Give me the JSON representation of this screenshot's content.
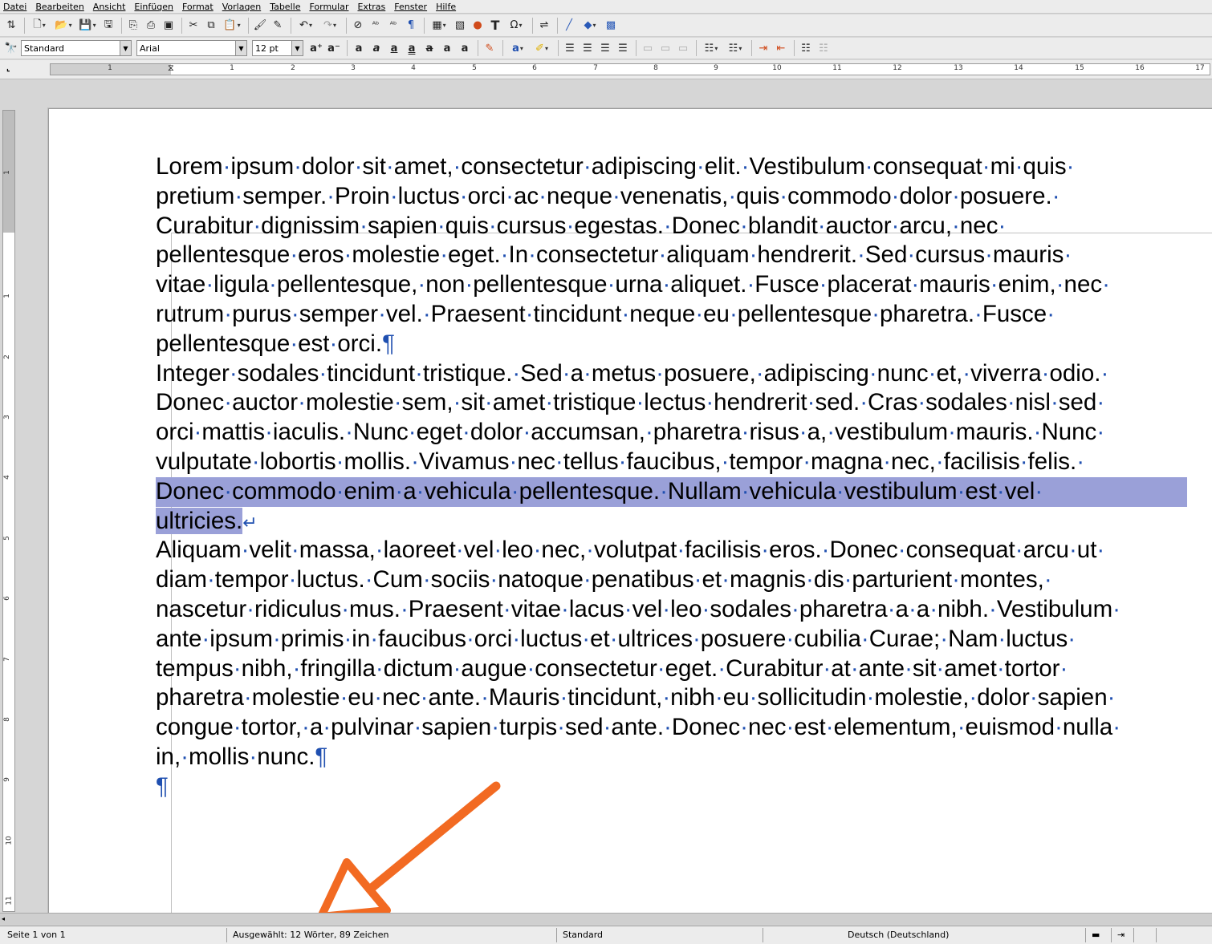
{
  "menu": [
    "Datei",
    "Bearbeiten",
    "Ansicht",
    "Einfügen",
    "Format",
    "Vorlagen",
    "Tabelle",
    "Formular",
    "Extras",
    "Fenster",
    "Hilfe"
  ],
  "toolbar2": {
    "style_value": "Standard",
    "font_value": "Arial",
    "size_value": "12 pt"
  },
  "ruler": {
    "h_ticks": [
      "1",
      "1",
      "2",
      "3",
      "4",
      "5",
      "6",
      "7",
      "8",
      "9",
      "10",
      "11",
      "12",
      "13",
      "14",
      "15",
      "16",
      "17"
    ],
    "v_ticks": [
      "1",
      "1",
      "2",
      "3",
      "4",
      "5",
      "6",
      "7",
      "8",
      "9",
      "10",
      "11"
    ]
  },
  "document": {
    "lines": [
      "Lorem·ipsum·dolor·sit·amet,·consectetur·adipiscing·elit.·Vestibulum·consequat·mi·quis·",
      "pretium·semper.·Proin·luctus·orci·ac·neque·venenatis,·quis·commodo·dolor·posuere.·",
      "Curabitur·dignissim·sapien·quis·cursus·egestas.·Donec·blandit·auctor·arcu,·nec·",
      "pellentesque·eros·molestie·eget.·In·consectetur·aliquam·hendrerit.·Sed·cursus·mauris·",
      "vitae·ligula·pellentesque,·non·pellentesque·urna·aliquet.·Fusce·placerat·mauris·enim,·nec·",
      "rutrum·purus·semper·vel.·Praesent·tincidunt·neque·eu·pellentesque·pharetra.·Fusce·",
      "pellentesque·est·orci.",
      "Integer·sodales·tincidunt·tristique.·Sed·a·metus·posuere,·adipiscing·nunc·et,·viverra·odio.·",
      "Donec·auctor·molestie·sem,·sit·amet·tristique·lectus·hendrerit·sed.·Cras·sodales·nisl·sed·",
      "orci·mattis·iaculis.·Nunc·eget·dolor·accumsan,·pharetra·risus·a,·vestibulum·mauris.·Nunc·",
      "vulputate·lobortis·mollis.·Vivamus·nec·tellus·faucibus,·tempor·magna·nec,·facilisis·felis.·",
      "Donec·commodo·enim·a·vehicula·pellentesque.·Nullam·vehicula·vestibulum·est·vel·",
      "ultricies.",
      "Aliquam·velit·massa,·laoreet·vel·leo·nec,·volutpat·facilisis·eros.·Donec·consequat·arcu·ut·",
      "diam·tempor·luctus.·Cum·sociis·natoque·penatibus·et·magnis·dis·parturient·montes,·",
      "nascetur·ridiculus·mus.·Praesent·vitae·lacus·vel·leo·sodales·pharetra·a·a·nibh.·Vestibulum·",
      "ante·ipsum·primis·in·faucibus·orci·luctus·et·ultrices·posuere·cubilia·Curae;·Nam·luctus·",
      "tempus·nibh,·fringilla·dictum·augue·consectetur·eget.·Curabitur·at·ante·sit·amet·tortor·",
      "pharetra·molestie·eu·nec·ante.·Mauris·tincidunt,·nibh·eu·sollicitudin·molestie,·dolor·sapien·",
      "congue·tortor,·a·pulvinar·sapien·turpis·sed·ante.·Donec·nec·est·elementum,·euismod·nulla·",
      "in,·mollis·nunc."
    ],
    "pilcrow": "¶",
    "line_break_mark": "↵"
  },
  "statusbar": {
    "page": "Seite 1 von 1",
    "selection": "Ausgewählt: 12 Wörter, 89 Zeichen",
    "page_style": "Standard",
    "language": "Deutsch (Deutschland)"
  },
  "colors": {
    "selection": "#9aa0d8",
    "formatting_marks": "#1f4fb0",
    "arrow": "#f26a22"
  }
}
